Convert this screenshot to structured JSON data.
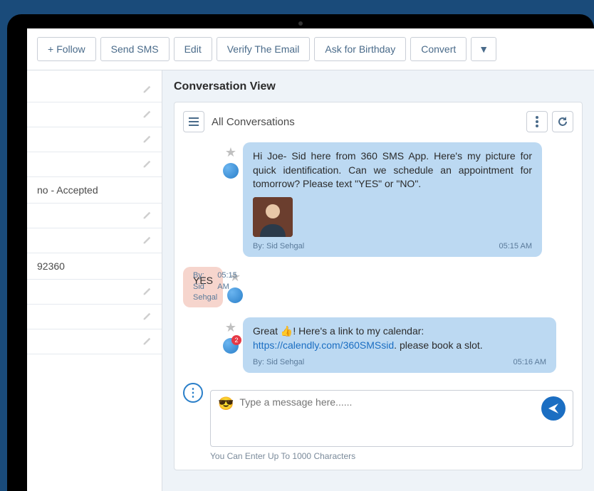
{
  "toolbar": {
    "follow": "Follow",
    "send_sms": "Send SMS",
    "edit": "Edit",
    "verify_email": "Verify The Email",
    "ask_birthday": "Ask for Birthday",
    "convert": "Convert"
  },
  "left_panel": {
    "rows": [
      {
        "text": ""
      },
      {
        "text": ""
      },
      {
        "text": ""
      },
      {
        "text": ""
      },
      {
        "text": "no - Accepted"
      },
      {
        "text": ""
      },
      {
        "text": ""
      },
      {
        "text": "92360"
      },
      {
        "text": ""
      },
      {
        "text": ""
      },
      {
        "text": ""
      }
    ]
  },
  "section": {
    "title": "Conversation View"
  },
  "header": {
    "title": "All Conversations"
  },
  "messages": {
    "m1": {
      "text": "Hi Joe- Sid here from 360 SMS App. Here's my picture for quick identification. Can we schedule an appointment for tomorrow? Please text \"YES\" or \"NO\".",
      "by": "By: Sid Sehgal",
      "time": "05:15 AM"
    },
    "m2": {
      "text": "YES",
      "by": "By: Sid Sehgal",
      "time": "05:15 AM"
    },
    "m3": {
      "text_before": "Great 👍! Here's a link to my calendar: ",
      "link": "https://calendly.com/360SMSsid",
      "text_after": ". please book a slot.",
      "by": "By: Sid Sehgal",
      "time": "05:16 AM",
      "badge": "2"
    }
  },
  "composer": {
    "placeholder": "Type a message here......",
    "hint": "You Can Enter Up To 1000 Characters"
  }
}
